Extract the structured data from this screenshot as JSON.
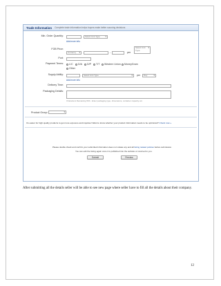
{
  "screenshot": {
    "title": "Trade Information",
    "subtitle": "Complete trade information helps buyers make better sourcing decisions",
    "min_order": {
      "label": "Min. Order Quantity:",
      "select": "Select Unit Type",
      "more": "Add more info"
    },
    "fob": {
      "label": "FOB Price:",
      "currency": "Currency",
      "dash": "-",
      "per": "per",
      "unit": "Select Unit Type"
    },
    "port": {
      "label": "Port:"
    },
    "payment": {
      "label": "Payment Terms:",
      "options": [
        "L/C",
        "D/A",
        "D/P",
        "T/T",
        "Western Union",
        "MoneyGram",
        "Other"
      ]
    },
    "supply": {
      "label": "Supply Ability:",
      "select": "Select Unit Type",
      "per": "per",
      "period": "Day",
      "more": "Add more info"
    },
    "delivery": {
      "label": "Delivery Time:"
    },
    "packaging": {
      "label": "Packaging Details:",
      "hint": "Characters Remaining 500 - Enter packaging type, dimensions, container capacity etc."
    },
    "product_group": {
      "label": "Product Group:"
    },
    "optimize": {
      "text": "It's easier for high quality products to get more exposure and inquiries! Want to know whether your product information needs to be optimized?",
      "link": "Check now"
    },
    "confirm": {
      "line1": "Please double check and confirm your submitted information does not violate any and all",
      "link": "listing related policies",
      "line1_end": "before submission.",
      "line2": "You can edit the listing again once it is published into the website or returned to you."
    },
    "buttons": {
      "submit": "Submit",
      "preview": "Preview"
    }
  },
  "caption": "After submitting all the details seller will be able to see new page where seller have to fill all the details about their company.",
  "page_number": "12"
}
